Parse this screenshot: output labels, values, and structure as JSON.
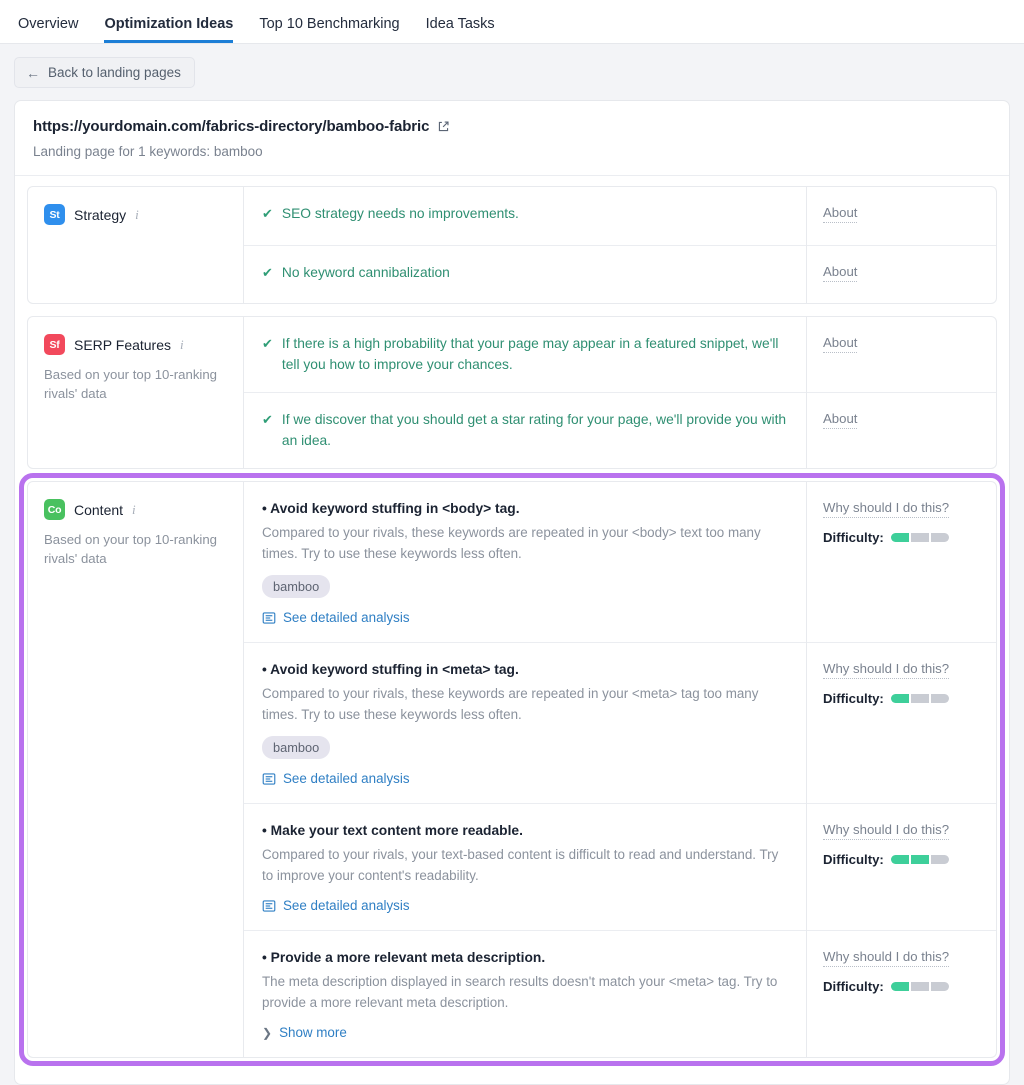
{
  "tabs": [
    {
      "label": "Overview",
      "active": false
    },
    {
      "label": "Optimization Ideas",
      "active": true
    },
    {
      "label": "Top 10 Benchmarking",
      "active": false
    },
    {
      "label": "Idea Tasks",
      "active": false
    }
  ],
  "back_button": {
    "label": "Back to landing pages",
    "arrow": "←"
  },
  "page": {
    "url": "https://yourdomain.com/fabrics-directory/bamboo-fabric",
    "external_icon": "external-link-icon",
    "subtitle": "Landing page for 1 keywords: bamboo"
  },
  "colors": {
    "accent_tab": "#1c7ed6",
    "highlight_outline": "#b972ee",
    "strategy_badge": "#2f8fed",
    "serp_badge": "#f2495c",
    "content_badge": "#49c15f",
    "ok_text": "#2f8f72",
    "link": "#2f7fc4",
    "difficulty_on": "#3ecf9a",
    "difficulty_off": "#c9ccd3"
  },
  "sections": [
    {
      "id": "strategy",
      "badge_text": "St",
      "badge_color": "#2f8fed",
      "name": "Strategy",
      "note": "",
      "highlighted": false,
      "kind": "ok",
      "items": [
        {
          "text": "SEO strategy needs no improvements.",
          "right_label": "About"
        },
        {
          "text": "No keyword cannibalization",
          "right_label": "About"
        }
      ]
    },
    {
      "id": "serp-features",
      "badge_text": "Sf",
      "badge_color": "#f2495c",
      "name": "SERP Features",
      "note": "Based on your top 10-ranking rivals' data",
      "highlighted": false,
      "kind": "ok",
      "items": [
        {
          "text": "If there is a high probability that your page may appear in a featured snippet, we'll tell you how to improve your chances.",
          "right_label": "About"
        },
        {
          "text": "If we discover that you should get a star rating for your page, we'll provide you with an idea.",
          "right_label": "About"
        }
      ]
    },
    {
      "id": "content",
      "badge_text": "Co",
      "badge_color": "#49c15f",
      "name": "Content",
      "note": "Based on your top 10-ranking rivals' data",
      "highlighted": true,
      "kind": "idea",
      "items": [
        {
          "title": "• Avoid keyword stuffing in <body> tag.",
          "desc": "Compared to your rivals, these keywords are repeated in your <body> text too many times. Try to use these keywords less often.",
          "chips": [
            "bamboo"
          ],
          "link_label": "See detailed analysis",
          "link_icon": "document-analysis-icon",
          "right_label": "Why should I do this?",
          "difficulty_label": "Difficulty:",
          "difficulty_filled": 1,
          "difficulty_total": 3
        },
        {
          "title": "• Avoid keyword stuffing in <meta> tag.",
          "desc": "Compared to your rivals, these keywords are repeated in your <meta> tag too many times. Try to use these keywords less often.",
          "chips": [
            "bamboo"
          ],
          "link_label": "See detailed analysis",
          "link_icon": "document-analysis-icon",
          "right_label": "Why should I do this?",
          "difficulty_label": "Difficulty:",
          "difficulty_filled": 1,
          "difficulty_total": 3
        },
        {
          "title": "• Make your text content more readable.",
          "desc": "Compared to your rivals, your text-based content is difficult to read and understand. Try to improve your content's readability.",
          "chips": [],
          "link_label": "See detailed analysis",
          "link_icon": "document-analysis-icon",
          "right_label": "Why should I do this?",
          "difficulty_label": "Difficulty:",
          "difficulty_filled": 2,
          "difficulty_total": 3
        },
        {
          "title": "• Provide a more relevant meta description.",
          "desc": "The meta description displayed in search results doesn't match your <meta> tag. Try to provide a more relevant meta description.",
          "chips": [],
          "link_label": "Show more",
          "link_icon": "chevron-right-icon",
          "right_label": "Why should I do this?",
          "difficulty_label": "Difficulty:",
          "difficulty_filled": 1,
          "difficulty_total": 3
        }
      ]
    }
  ]
}
